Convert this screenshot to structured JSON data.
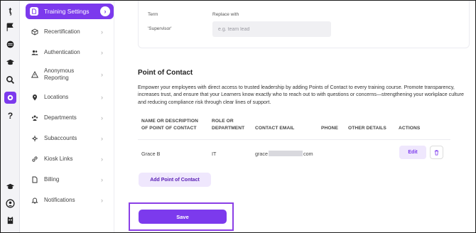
{
  "sidebar": {
    "items": [
      {
        "label": "Training Settings",
        "icon": "file-icon"
      },
      {
        "label": "Recertification",
        "icon": "box-icon"
      },
      {
        "label": "Authentication",
        "icon": "users-icon"
      },
      {
        "label": "Anonymous Reporting",
        "label_line1": "Anonymous",
        "label_line2": "Reporting",
        "icon": "warning-icon"
      },
      {
        "label": "Locations",
        "icon": "location-pin-icon"
      },
      {
        "label": "Departments",
        "icon": "team-icon"
      },
      {
        "label": "Subaccounts",
        "icon": "split-icon"
      },
      {
        "label": "Kiosk Links",
        "icon": "link-icon"
      },
      {
        "label": "Billing",
        "icon": "document-icon"
      },
      {
        "label": "Notifications",
        "icon": "bell-icon"
      }
    ]
  },
  "terms": {
    "term_header": "Term",
    "replace_header": "Replace with",
    "term_value": "'Supervisor'",
    "replace_placeholder": "e.g. team lead"
  },
  "poc": {
    "title": "Point of Contact",
    "description": "Empower your employees with direct access to trusted leadership by adding Points of Contact to every training course. Promote transparency, increases trust, and ensure that your Learners know exactly who to reach out to with questions or concerns—strengthening your workplace culture and reducing compliance risk through clear lines of support.",
    "columns": {
      "name_line1": "Name or Description",
      "name_line2": "of Point of Contact",
      "role_line1": "Role or",
      "role_line2": "Department",
      "email": "Contact Email",
      "phone": "Phone",
      "other": "Other Details",
      "actions": "Actions"
    },
    "rows": [
      {
        "name": "Grace B",
        "role": "IT",
        "email_prefix": "grace",
        "email_suffix": "com",
        "phone": "",
        "other": ""
      }
    ],
    "edit_label": "Edit",
    "add_label": "Add Point of Contact"
  },
  "save_label": "Save",
  "colors": {
    "accent": "#7c3aed",
    "accent_light": "#efe7fd"
  }
}
